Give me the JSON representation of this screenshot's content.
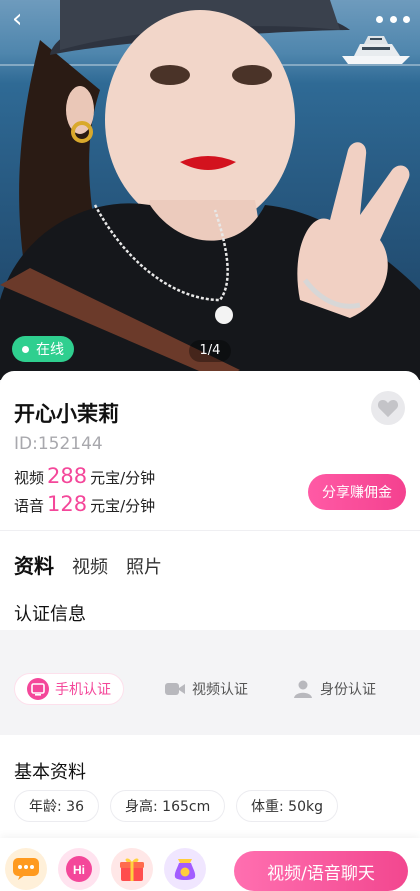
{
  "hero": {
    "online_label": "在线",
    "photo_counter": "1/4"
  },
  "profile": {
    "name": "开心小茉莉",
    "id_text": "ID:152144",
    "video_price": {
      "label": "视频",
      "value": "288",
      "unit": "元宝/分钟"
    },
    "voice_price": {
      "label": "语音",
      "value": "128",
      "unit": "元宝/分钟"
    },
    "share_label": "分享赚佣金"
  },
  "tabs": [
    {
      "label": "资料",
      "active": true
    },
    {
      "label": "视频",
      "active": false
    },
    {
      "label": "照片",
      "active": false
    }
  ],
  "verification": {
    "title": "认证信息",
    "items": [
      {
        "label": "手机认证",
        "icon": "phone-verify-icon",
        "verified": true
      },
      {
        "label": "视频认证",
        "icon": "video-verify-icon",
        "verified": false
      },
      {
        "label": "身份认证",
        "icon": "id-verify-icon",
        "verified": false
      }
    ]
  },
  "basic": {
    "title": "基本资料",
    "chips": [
      "年龄: 36",
      "身高: 165cm",
      "体重: 50kg"
    ]
  },
  "bottom_bar": {
    "call_label": "视频/语音聊天",
    "actions": [
      "message-icon",
      "hi-icon",
      "gift-icon",
      "lucky-bag-icon"
    ]
  },
  "colors": {
    "accent": "#f4479a",
    "online": "#2fcf8f"
  }
}
